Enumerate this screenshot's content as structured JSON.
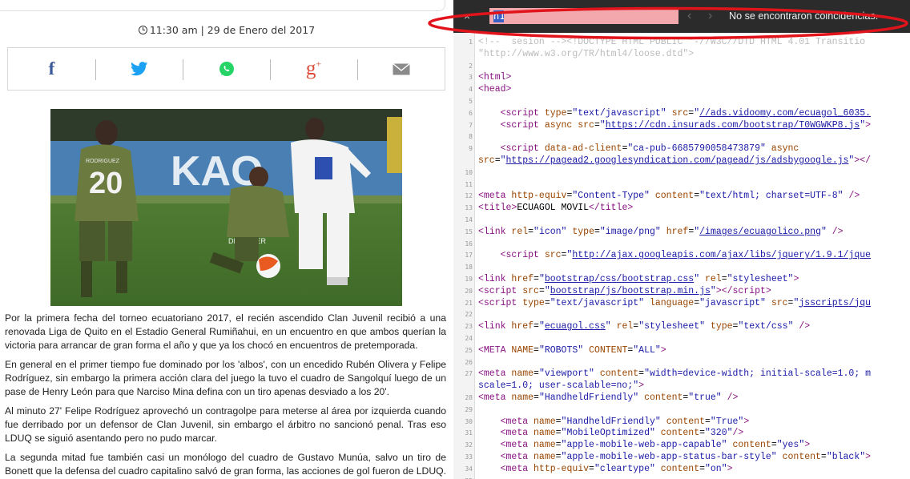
{
  "article": {
    "datetime": "11:30 am | 29 de Enero del 2017",
    "share": [
      {
        "icon": "facebook-icon",
        "label": "f"
      },
      {
        "icon": "twitter-icon",
        "label": ""
      },
      {
        "icon": "whatsapp-icon",
        "label": ""
      },
      {
        "icon": "google-plus-icon",
        "label": "g+"
      },
      {
        "icon": "email-icon",
        "label": ""
      }
    ],
    "photo_text": {
      "jersey_number": "20",
      "jersey_name": "RODRIGUEZ",
      "sponsor": "DISCOVER",
      "banner": "KAO"
    },
    "paragraphs": [
      "Por la primera fecha del torneo ecuatoriano 2017, el recién ascendido Clan Juvenil recibió a una renovada Liga de Quito en el Estadio General Rumiñahui, en un encuentro en que ambos querían la victoria para arrancar de gran forma el año y que ya los chocó en encuentros de pretemporada.",
      "En general en el primer tiempo fue dominado por los 'albos', con un encedido Rubén Olivera y Felipe Rodríguez, sin embargo la primera acción clara del juego la tuvo el cuadro de Sangolquí luego de un pase de Henry León para que Narciso Mina defina con un tiro apenas desviado a los 20'.",
      "Al minuto 27' Felipe Rodríguez aprovechó un contragolpe para meterse al área por izquierda cuando fue derribado por un defensor de Clan Juvenil, sin embargo el árbitro no sancionó penal. Tras eso LDUQ se siguió asentando pero no pudo marcar.",
      "La segunda mitad fue también casi un monólogo del cuadro de Gustavo Munúa, salvo un tiro de Bonett que la defensa del cuadro capitalino salvó de gran forma, las acciones de gol fueron de LDUQ. Al minuto"
    ]
  },
  "find_bar": {
    "close_label": "×",
    "query": "h1",
    "prev_label": "‹",
    "next_label": "›",
    "status": "No se encontraron coincidencias."
  },
  "source_lines": [
    {
      "n": "1",
      "html": "<span class=\"fade\">&lt;!--  sesion --&gt;</span><span class=\"fade\">&lt;!DOCTYPE HTML PUBLIC \"-//W3C//DTD HTML 4.01 Transitio</span>"
    },
    {
      "n": "",
      "html": "<span class=\"fade\">\"http://www.w3.org/TR/html4/loose.dtd\"&gt;</span>"
    },
    {
      "n": "2",
      "html": ""
    },
    {
      "n": "3",
      "html": "<span class=\"tag\">&lt;html&gt;</span>"
    },
    {
      "n": "4",
      "html": "<span class=\"tag\">&lt;head&gt;</span>"
    },
    {
      "n": "5",
      "html": ""
    },
    {
      "n": "6",
      "html": "    <span class=\"tag\">&lt;script</span> <span class=\"attr\">type</span>=<span class=\"val\">\"text/javascript\"</span> <span class=\"attr\">src</span>=<span class=\"val\">\"</span><span class=\"link\">//ads.vidoomy.com/ecuagol_6035.</span>"
    },
    {
      "n": "7",
      "html": "    <span class=\"tag\">&lt;script</span> <span class=\"attr\">async src</span>=<span class=\"val\">\"</span><span class=\"link\">https://cdn.insurads.com/bootstrap/T0WGWKP8.js</span><span class=\"val\">\"</span><span class=\"tag\">&gt;</span>"
    },
    {
      "n": "8",
      "html": ""
    },
    {
      "n": "9",
      "html": "    <span class=\"tag\">&lt;script</span> <span class=\"attr\">data-ad-client</span>=<span class=\"val\">\"ca-pub-6685790058473879\"</span> <span class=\"attr\">async</span>"
    },
    {
      "n": "",
      "html": "<span class=\"attr\">src</span>=<span class=\"val\">\"</span><span class=\"link\">https://pagead2.googlesyndication.com/pagead/js/adsbygoogle.js</span><span class=\"val\">\"</span><span class=\"tag\">&gt;&lt;/</span>"
    },
    {
      "n": "10",
      "html": ""
    },
    {
      "n": "11",
      "html": ""
    },
    {
      "n": "12",
      "html": "<span class=\"tag\">&lt;meta</span> <span class=\"attr\">http-equiv</span>=<span class=\"val\">\"Content-Type\"</span> <span class=\"attr\">content</span>=<span class=\"val\">\"text/html; charset=UTF-8\"</span> <span class=\"tag\">/&gt;</span>"
    },
    {
      "n": "13",
      "html": "<span class=\"tag\">&lt;title&gt;</span>ECUAGOL MOVIL<span class=\"tag\">&lt;/title&gt;</span>"
    },
    {
      "n": "14",
      "html": ""
    },
    {
      "n": "15",
      "html": "<span class=\"tag\">&lt;link</span> <span class=\"attr\">rel</span>=<span class=\"val\">\"icon\"</span> <span class=\"attr\">type</span>=<span class=\"val\">\"image/png\"</span> <span class=\"attr\">href</span>=<span class=\"val\">\"</span><span class=\"link\">/images/ecuagolico.png</span><span class=\"val\">\"</span> <span class=\"tag\">/&gt;</span>"
    },
    {
      "n": "16",
      "html": ""
    },
    {
      "n": "17",
      "html": "    <span class=\"tag\">&lt;script</span> <span class=\"attr\">src</span>=<span class=\"val\">\"</span><span class=\"link\">http://ajax.googleapis.com/ajax/libs/jquery/1.9.1/jque</span>"
    },
    {
      "n": "18",
      "html": ""
    },
    {
      "n": "19",
      "html": "<span class=\"tag\">&lt;link</span> <span class=\"attr\">href</span>=<span class=\"val\">\"</span><span class=\"link\">bootstrap/css/bootstrap.css</span><span class=\"val\">\"</span> <span class=\"attr\">rel</span>=<span class=\"val\">\"stylesheet\"</span><span class=\"tag\">&gt;</span>"
    },
    {
      "n": "20",
      "html": "<span class=\"tag\">&lt;script</span> <span class=\"attr\">src</span>=<span class=\"val\">\"</span><span class=\"link\">bootstrap/js/bootstrap.min.js</span><span class=\"val\">\"</span><span class=\"tag\">&gt;&lt;/script&gt;</span>"
    },
    {
      "n": "21",
      "html": "<span class=\"tag\">&lt;script</span> <span class=\"attr\">type</span>=<span class=\"val\">\"text/javascript\"</span> <span class=\"attr\">language</span>=<span class=\"val\">\"javascript\"</span> <span class=\"attr\">src</span>=<span class=\"val\">\"</span><span class=\"link\">jsscripts/jqu</span>"
    },
    {
      "n": "22",
      "html": ""
    },
    {
      "n": "23",
      "html": "<span class=\"tag\">&lt;link</span> <span class=\"attr\">href</span>=<span class=\"val\">\"</span><span class=\"link\">ecuagol.css</span><span class=\"val\">\"</span> <span class=\"attr\">rel</span>=<span class=\"val\">\"stylesheet\"</span> <span class=\"attr\">type</span>=<span class=\"val\">\"text/css\"</span> <span class=\"tag\">/&gt;</span>"
    },
    {
      "n": "24",
      "html": ""
    },
    {
      "n": "25",
      "html": "<span class=\"tag\">&lt;META</span> <span class=\"attr\">NAME</span>=<span class=\"val\">\"ROBOTS\"</span> <span class=\"attr\">CONTENT</span>=<span class=\"val\">\"ALL\"</span><span class=\"tag\">&gt;</span>"
    },
    {
      "n": "26",
      "html": ""
    },
    {
      "n": "27",
      "html": "<span class=\"tag\">&lt;meta</span> <span class=\"attr\">name</span>=<span class=\"val\">\"viewport\"</span> <span class=\"attr\">content</span>=<span class=\"val\">\"width=device-width; initial-scale=1.0; m</span>"
    },
    {
      "n": "",
      "html": "<span class=\"val\">scale=1.0; user-scalable=no;\"</span><span class=\"tag\">&gt;</span>"
    },
    {
      "n": "28",
      "html": "<span class=\"tag\">&lt;meta</span> <span class=\"attr\">name</span>=<span class=\"val\">\"HandheldFriendly\"</span> <span class=\"attr\">content</span>=<span class=\"val\">\"true\"</span> <span class=\"tag\">/&gt;</span>"
    },
    {
      "n": "29",
      "html": ""
    },
    {
      "n": "30",
      "html": "    <span class=\"tag\">&lt;meta</span> <span class=\"attr\">name</span>=<span class=\"val\">\"HandheldFriendly\"</span> <span class=\"attr\">content</span>=<span class=\"val\">\"True\"</span><span class=\"tag\">&gt;</span>"
    },
    {
      "n": "31",
      "html": "    <span class=\"tag\">&lt;meta</span> <span class=\"attr\">name</span>=<span class=\"val\">\"MobileOptimized\"</span> <span class=\"attr\">content</span>=<span class=\"val\">\"320\"</span><span class=\"tag\">/&gt;</span>"
    },
    {
      "n": "32",
      "html": "    <span class=\"tag\">&lt;meta</span> <span class=\"attr\">name</span>=<span class=\"val\">\"apple-mobile-web-app-capable\"</span> <span class=\"attr\">content</span>=<span class=\"val\">\"yes\"</span><span class=\"tag\">&gt;</span>"
    },
    {
      "n": "33",
      "html": "    <span class=\"tag\">&lt;meta</span> <span class=\"attr\">name</span>=<span class=\"val\">\"apple-mobile-web-app-status-bar-style\"</span> <span class=\"attr\">content</span>=<span class=\"val\">\"black\"</span><span class=\"tag\">&gt;</span>"
    },
    {
      "n": "34",
      "html": "    <span class=\"tag\">&lt;meta</span> <span class=\"attr\">http-equiv</span>=<span class=\"val\">\"cleartype\"</span> <span class=\"attr\">content</span>=<span class=\"val\">\"on\"</span><span class=\"tag\">&gt;</span>"
    },
    {
      "n": "35",
      "html": ""
    }
  ],
  "colors": {
    "annotation": "#e2141b",
    "facebook": "#3b5998",
    "twitter": "#1da1f2",
    "whatsapp": "#25d366",
    "google_plus": "#dd4b39",
    "email": "#888888",
    "find_bar_bg": "#2b2b2b",
    "find_input_bg": "#f2a8ac"
  }
}
